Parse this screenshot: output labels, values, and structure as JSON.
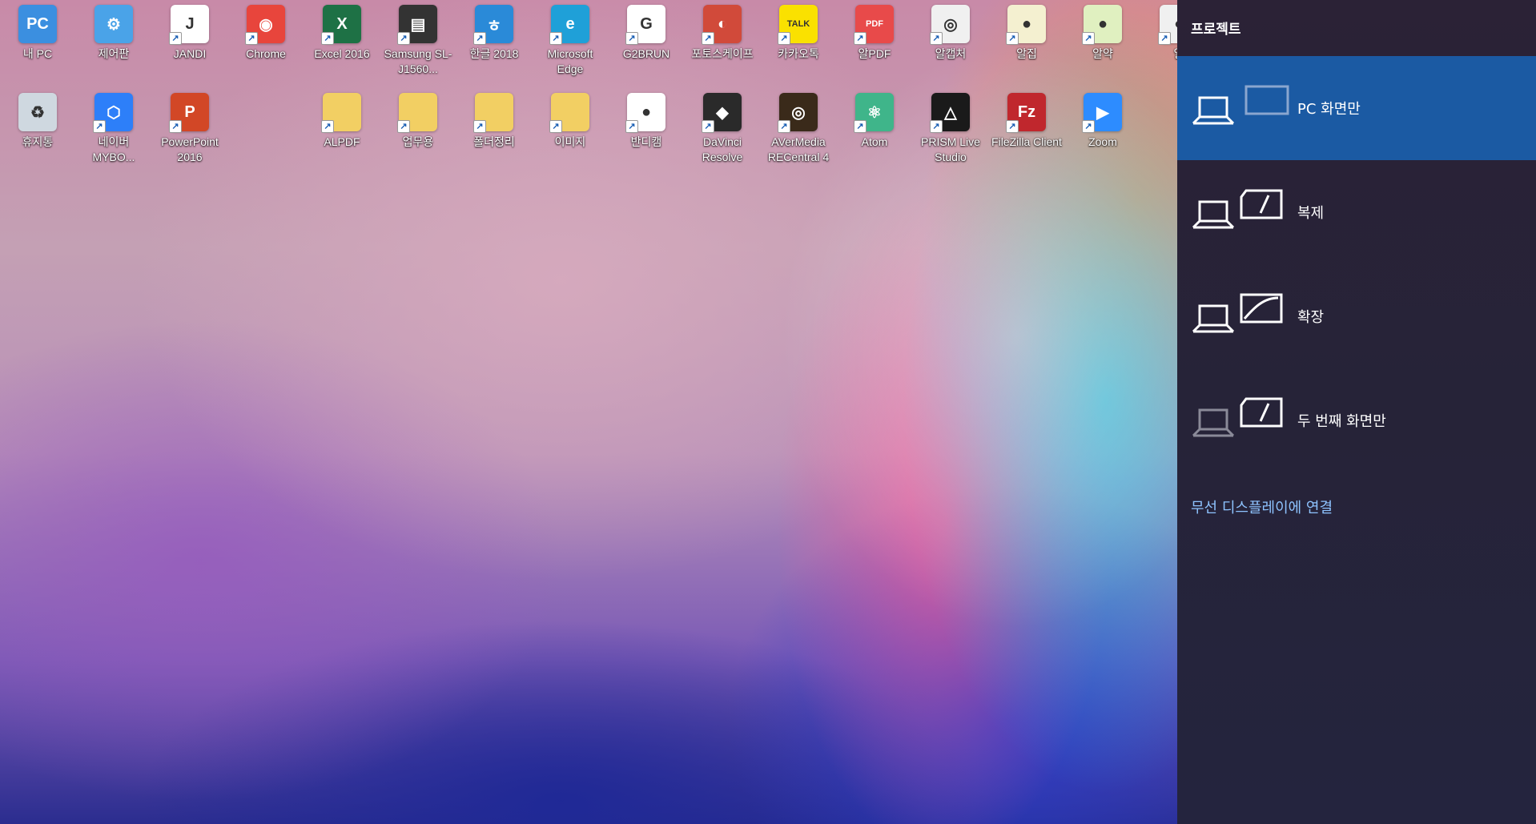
{
  "desktop": {
    "icons": [
      {
        "label": "내 PC",
        "icon": "this-pc-icon",
        "color": "#3b8fe0",
        "glyph": "PC"
      },
      {
        "label": "제어판",
        "icon": "control-panel-icon",
        "color": "#4aa3e8",
        "glyph": "⚙"
      },
      {
        "label": "JANDI",
        "icon": "jandi-icon",
        "color": "#ffffff",
        "glyph": "J"
      },
      {
        "label": "Chrome",
        "icon": "chrome-icon",
        "color": "#e8453c",
        "glyph": "◉"
      },
      {
        "label": "Excel 2016",
        "icon": "excel-icon",
        "color": "#1e7145",
        "glyph": "X"
      },
      {
        "label": "Samsung SL-J1560...",
        "icon": "printer-icon",
        "color": "#333333",
        "glyph": "▤"
      },
      {
        "label": "한글 2018",
        "icon": "hangul-icon",
        "color": "#2a8ad8",
        "glyph": "ㅎ"
      },
      {
        "label": "Microsoft Edge",
        "icon": "edge-icon",
        "color": "#1fa0d8",
        "glyph": "e"
      },
      {
        "label": "G2BRUN",
        "icon": "g2brun-icon",
        "color": "#ffffff",
        "glyph": "G"
      },
      {
        "label": "포토스케이프",
        "icon": "photoscape-icon",
        "color": "#d14a3a",
        "glyph": "◐"
      },
      {
        "label": "카카오톡",
        "icon": "kakaotalk-icon",
        "color": "#fae100",
        "glyph": "TALK"
      },
      {
        "label": "알PDF",
        "icon": "alpdf-icon",
        "color": "#e84a4a",
        "glyph": "PDF"
      },
      {
        "label": "알캡처",
        "icon": "alcapture-icon",
        "color": "#f0f0f0",
        "glyph": "◎"
      },
      {
        "label": "알집",
        "icon": "alzip-icon",
        "color": "#f4f0d0",
        "glyph": "●"
      },
      {
        "label": "알약",
        "icon": "alyac-icon",
        "color": "#e0f0c0",
        "glyph": "●"
      },
      {
        "label": "알",
        "icon": "al-app-icon",
        "color": "#f0f0f0",
        "glyph": "●"
      }
    ],
    "icons_row2": [
      {
        "label": "휴지통",
        "icon": "recycle-bin-icon",
        "color": "#cfd8e0",
        "glyph": "♻"
      },
      {
        "label": "네이버 MYBO...",
        "icon": "naver-mybox-icon",
        "color": "#2d7ff9",
        "glyph": "⬡"
      },
      {
        "label": "PowerPoint 2016",
        "icon": "powerpoint-icon",
        "color": "#d24726",
        "glyph": "P"
      },
      {
        "label": "ALPDF",
        "icon": "folder-icon",
        "color": "#f2cf63",
        "glyph": ""
      },
      {
        "label": "업무용",
        "icon": "folder-icon",
        "color": "#f2cf63",
        "glyph": ""
      },
      {
        "label": "폴더정리",
        "icon": "folder-icon",
        "color": "#f2cf63",
        "glyph": ""
      },
      {
        "label": "이미지",
        "icon": "folder-icon",
        "color": "#f2cf63",
        "glyph": ""
      },
      {
        "label": "반디캠",
        "icon": "bandicam-icon",
        "color": "#ffffff",
        "glyph": "●"
      },
      {
        "label": "DaVinci Resolve",
        "icon": "davinci-resolve-icon",
        "color": "#2a2a2a",
        "glyph": "◆"
      },
      {
        "label": "AVerMedia RECentral 4",
        "icon": "avermedia-icon",
        "color": "#3a2a1a",
        "glyph": "◎"
      },
      {
        "label": "Atom",
        "icon": "atom-icon",
        "color": "#3fb58a",
        "glyph": "⚛"
      },
      {
        "label": "PRISM Live Studio",
        "icon": "prism-live-icon",
        "color": "#1a1a1a",
        "glyph": "△"
      },
      {
        "label": "FileZilla Client",
        "icon": "filezilla-icon",
        "color": "#c0272d",
        "glyph": "Fz"
      },
      {
        "label": "Zoom",
        "icon": "zoom-icon",
        "color": "#2d8cff",
        "glyph": "▶"
      }
    ]
  },
  "project_panel": {
    "title": "프로젝트",
    "options": [
      {
        "label": "PC 화면만",
        "icon": "pc-screen-only-icon",
        "selected": true
      },
      {
        "label": "복제",
        "icon": "duplicate-icon",
        "selected": false
      },
      {
        "label": "확장",
        "icon": "extend-icon",
        "selected": false
      },
      {
        "label": "두 번째 화면만",
        "icon": "second-screen-only-icon",
        "selected": false
      }
    ],
    "wireless_link": "무선 디스플레이에 연결",
    "colors": {
      "selected_bg": "#1b5aa3",
      "link": "#8ec3ff"
    }
  }
}
